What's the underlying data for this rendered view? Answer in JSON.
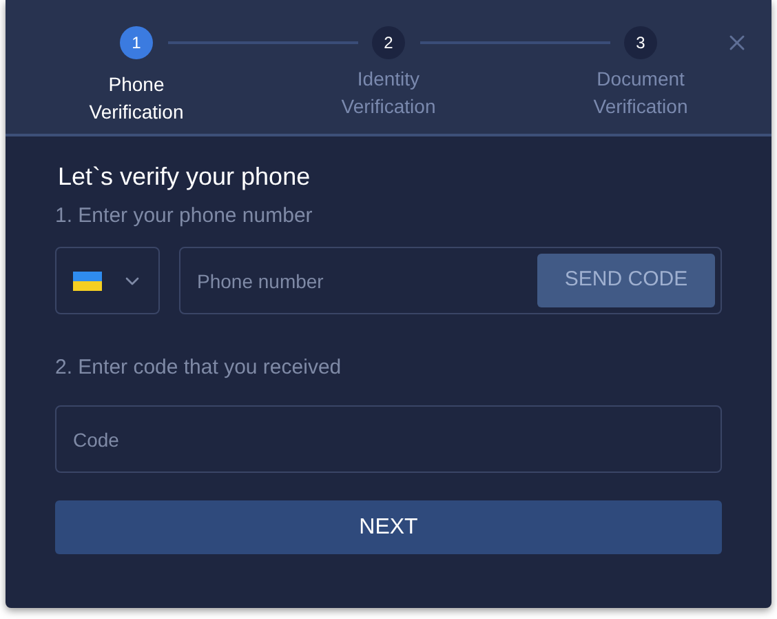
{
  "steps": [
    {
      "number": "1",
      "label": "Phone Verification",
      "selected": true
    },
    {
      "number": "2",
      "label": "Identity Verification",
      "selected": false
    },
    {
      "number": "3",
      "label": "Document Verification",
      "selected": false
    }
  ],
  "title": "Let`s verify your phone",
  "phone_section": {
    "heading": "1. Enter your phone number",
    "phone_field": {
      "placeholder": "Phone number"
    },
    "send_button": {
      "label": "SEND CODE",
      "disabled": true
    }
  },
  "code_section": {
    "heading": "2. Enter code that you received",
    "code_field": {
      "placeholder": "Code"
    }
  },
  "next_button": {
    "label": "NEXT"
  }
}
